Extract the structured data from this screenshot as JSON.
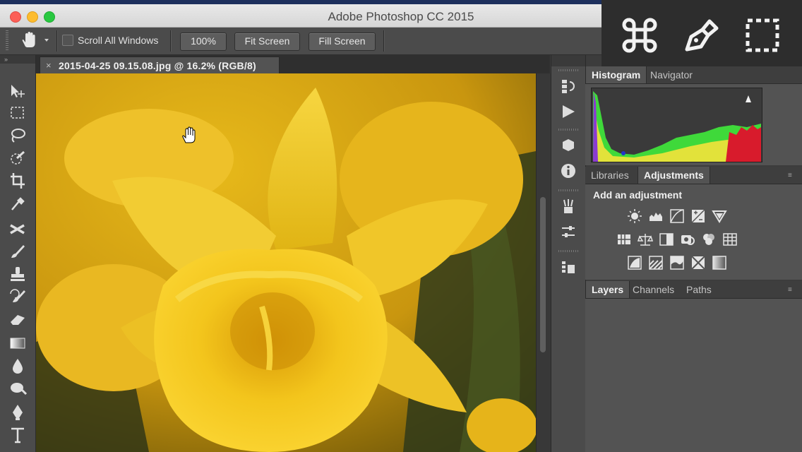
{
  "window": {
    "title": "Adobe Photoshop CC 2015"
  },
  "options_bar": {
    "scroll_all_windows": "Scroll All Windows",
    "zoom_100": "100%",
    "fit_screen": "Fit Screen",
    "fill_screen": "Fill Screen"
  },
  "document": {
    "tab_close": "×",
    "tab_title": "2015-04-25 09.15.08.jpg @ 16.2% (RGB/8)"
  },
  "panels": {
    "top_tabs": [
      "Histogram",
      "Navigator"
    ],
    "middle_tabs": [
      "Libraries",
      "Adjustments"
    ],
    "adjustments_heading": "Add an adjustment",
    "bottom_tabs": [
      "Layers",
      "Channels",
      "Paths"
    ]
  },
  "overlay_icons": [
    "command-key-icon",
    "pen-tool-icon",
    "marquee-selection-icon"
  ],
  "colors": {
    "accent_flower": "#f2c418",
    "ui_dark": "#2d2d2d",
    "ui_panel": "#535353"
  }
}
